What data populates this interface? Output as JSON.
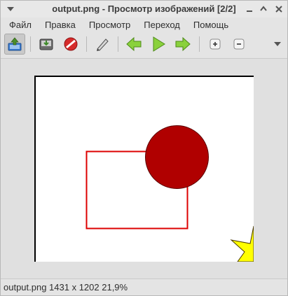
{
  "window": {
    "title": "output.png - Просмотр изображений [2/2]"
  },
  "menubar": {
    "items": [
      "Файл",
      "Правка",
      "Просмотр",
      "Переход",
      "Помощь"
    ]
  },
  "toolbar": {
    "icons": [
      "open-icon",
      "save-icon",
      "delete-icon",
      "edit-icon",
      "back-arrow-icon",
      "play-icon",
      "forward-arrow-icon",
      "zoom-in-icon",
      "zoom-out-icon",
      "overflow-icon"
    ]
  },
  "image": {
    "colors": {
      "rect_stroke": "#dd0000",
      "circle_fill": "#b00000",
      "star_fill": "#ffff00",
      "border": "#000000"
    }
  },
  "status": {
    "text": "output.png 1431 x 1202 21,9%"
  }
}
